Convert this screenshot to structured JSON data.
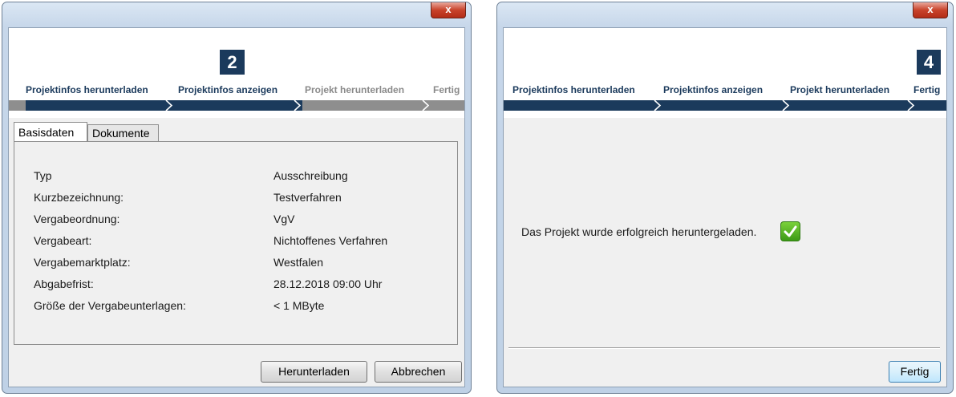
{
  "dialog1": {
    "close_label": "x",
    "step_number": "2",
    "steps": [
      "Projektinfos herunterladen",
      "Projektinfos anzeigen",
      "Projekt herunterladen",
      "Fertig"
    ],
    "tabs": [
      "Basisdaten",
      "Dokumente"
    ],
    "fields": [
      {
        "label": "Typ",
        "value": "Ausschreibung"
      },
      {
        "label": "Kurzbezeichnung:",
        "value": "Testverfahren"
      },
      {
        "label": "Vergabeordnung:",
        "value": "VgV"
      },
      {
        "label": "Vergabeart:",
        "value": "Nichtoffenes Verfahren"
      },
      {
        "label": "Vergabemarktplatz:",
        "value": "Westfalen"
      },
      {
        "label": "Abgabefrist:",
        "value": "28.12.2018 09:00 Uhr"
      },
      {
        "label": "Größe der Vergabeunterlagen:",
        "value": "< 1 MByte"
      }
    ],
    "buttons": {
      "download": "Herunterladen",
      "cancel": "Abbrechen"
    }
  },
  "dialog2": {
    "close_label": "x",
    "step_number": "4",
    "steps": [
      "Projektinfos herunterladen",
      "Projektinfos anzeigen",
      "Projekt herunterladen",
      "Fertig"
    ],
    "message": "Das Projekt wurde erfolgreich heruntergeladen.",
    "buttons": {
      "finish": "Fertig"
    }
  },
  "colors": {
    "step_active": "#1b3a5c",
    "step_inactive": "#8e8e8e",
    "success": "#3c9a16"
  }
}
